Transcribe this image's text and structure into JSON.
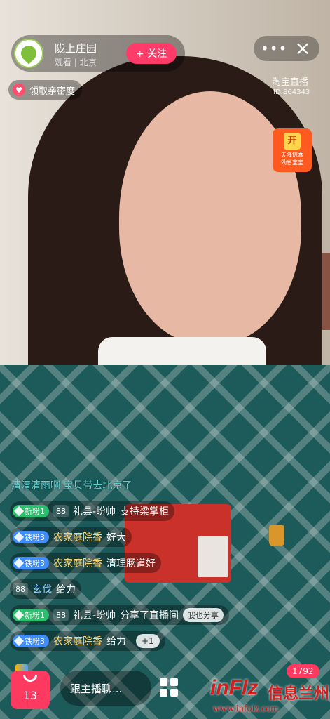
{
  "header": {
    "shop_name": "陇上庄园",
    "viewers_label": "观看",
    "location": "北京",
    "follow_label": "+ 关注",
    "more_icon": "more-icon",
    "close_icon": "close-icon"
  },
  "intimacy": {
    "label": "领取亲密度",
    "icon": "heart-icon"
  },
  "watermark": {
    "title": "淘宝直播",
    "id": "ID:864343"
  },
  "promo": {
    "icon_text": "开",
    "line1": "天降惊喜",
    "line2": "劲省宝宝"
  },
  "chat": {
    "header": "清清清雨啊 宝贝带去北京了",
    "rows": [
      {
        "level": "新粉1",
        "fan": "88",
        "name": "礼县-盼帅",
        "message": "支持梁掌柜"
      },
      {
        "level": "铁粉3",
        "name": "农家庭院香",
        "message": "好大"
      },
      {
        "level": "铁粉3",
        "name": "农家庭院香",
        "message": "清理肠道好"
      },
      {
        "fan": "88",
        "name": "玄伐",
        "message": "给力"
      },
      {
        "level": "新粉1",
        "fan": "88",
        "name": "礼县-盼帅",
        "message": "分享了直播间",
        "chip": "我也分享"
      },
      {
        "level": "铁粉3",
        "name": "农家庭院香",
        "message": "给力",
        "chip": "+1"
      }
    ]
  },
  "bottom": {
    "bag_count": "13",
    "input_placeholder": "跟主播聊...",
    "like_count": "1792"
  },
  "logo": {
    "mark": "inFlz",
    "cn": "信息兰州",
    "url": "www.infolz.com"
  },
  "colors": {
    "accent": "#ff3a61",
    "follow": "#ff3b6a",
    "gold_name": "#ffd46a"
  }
}
